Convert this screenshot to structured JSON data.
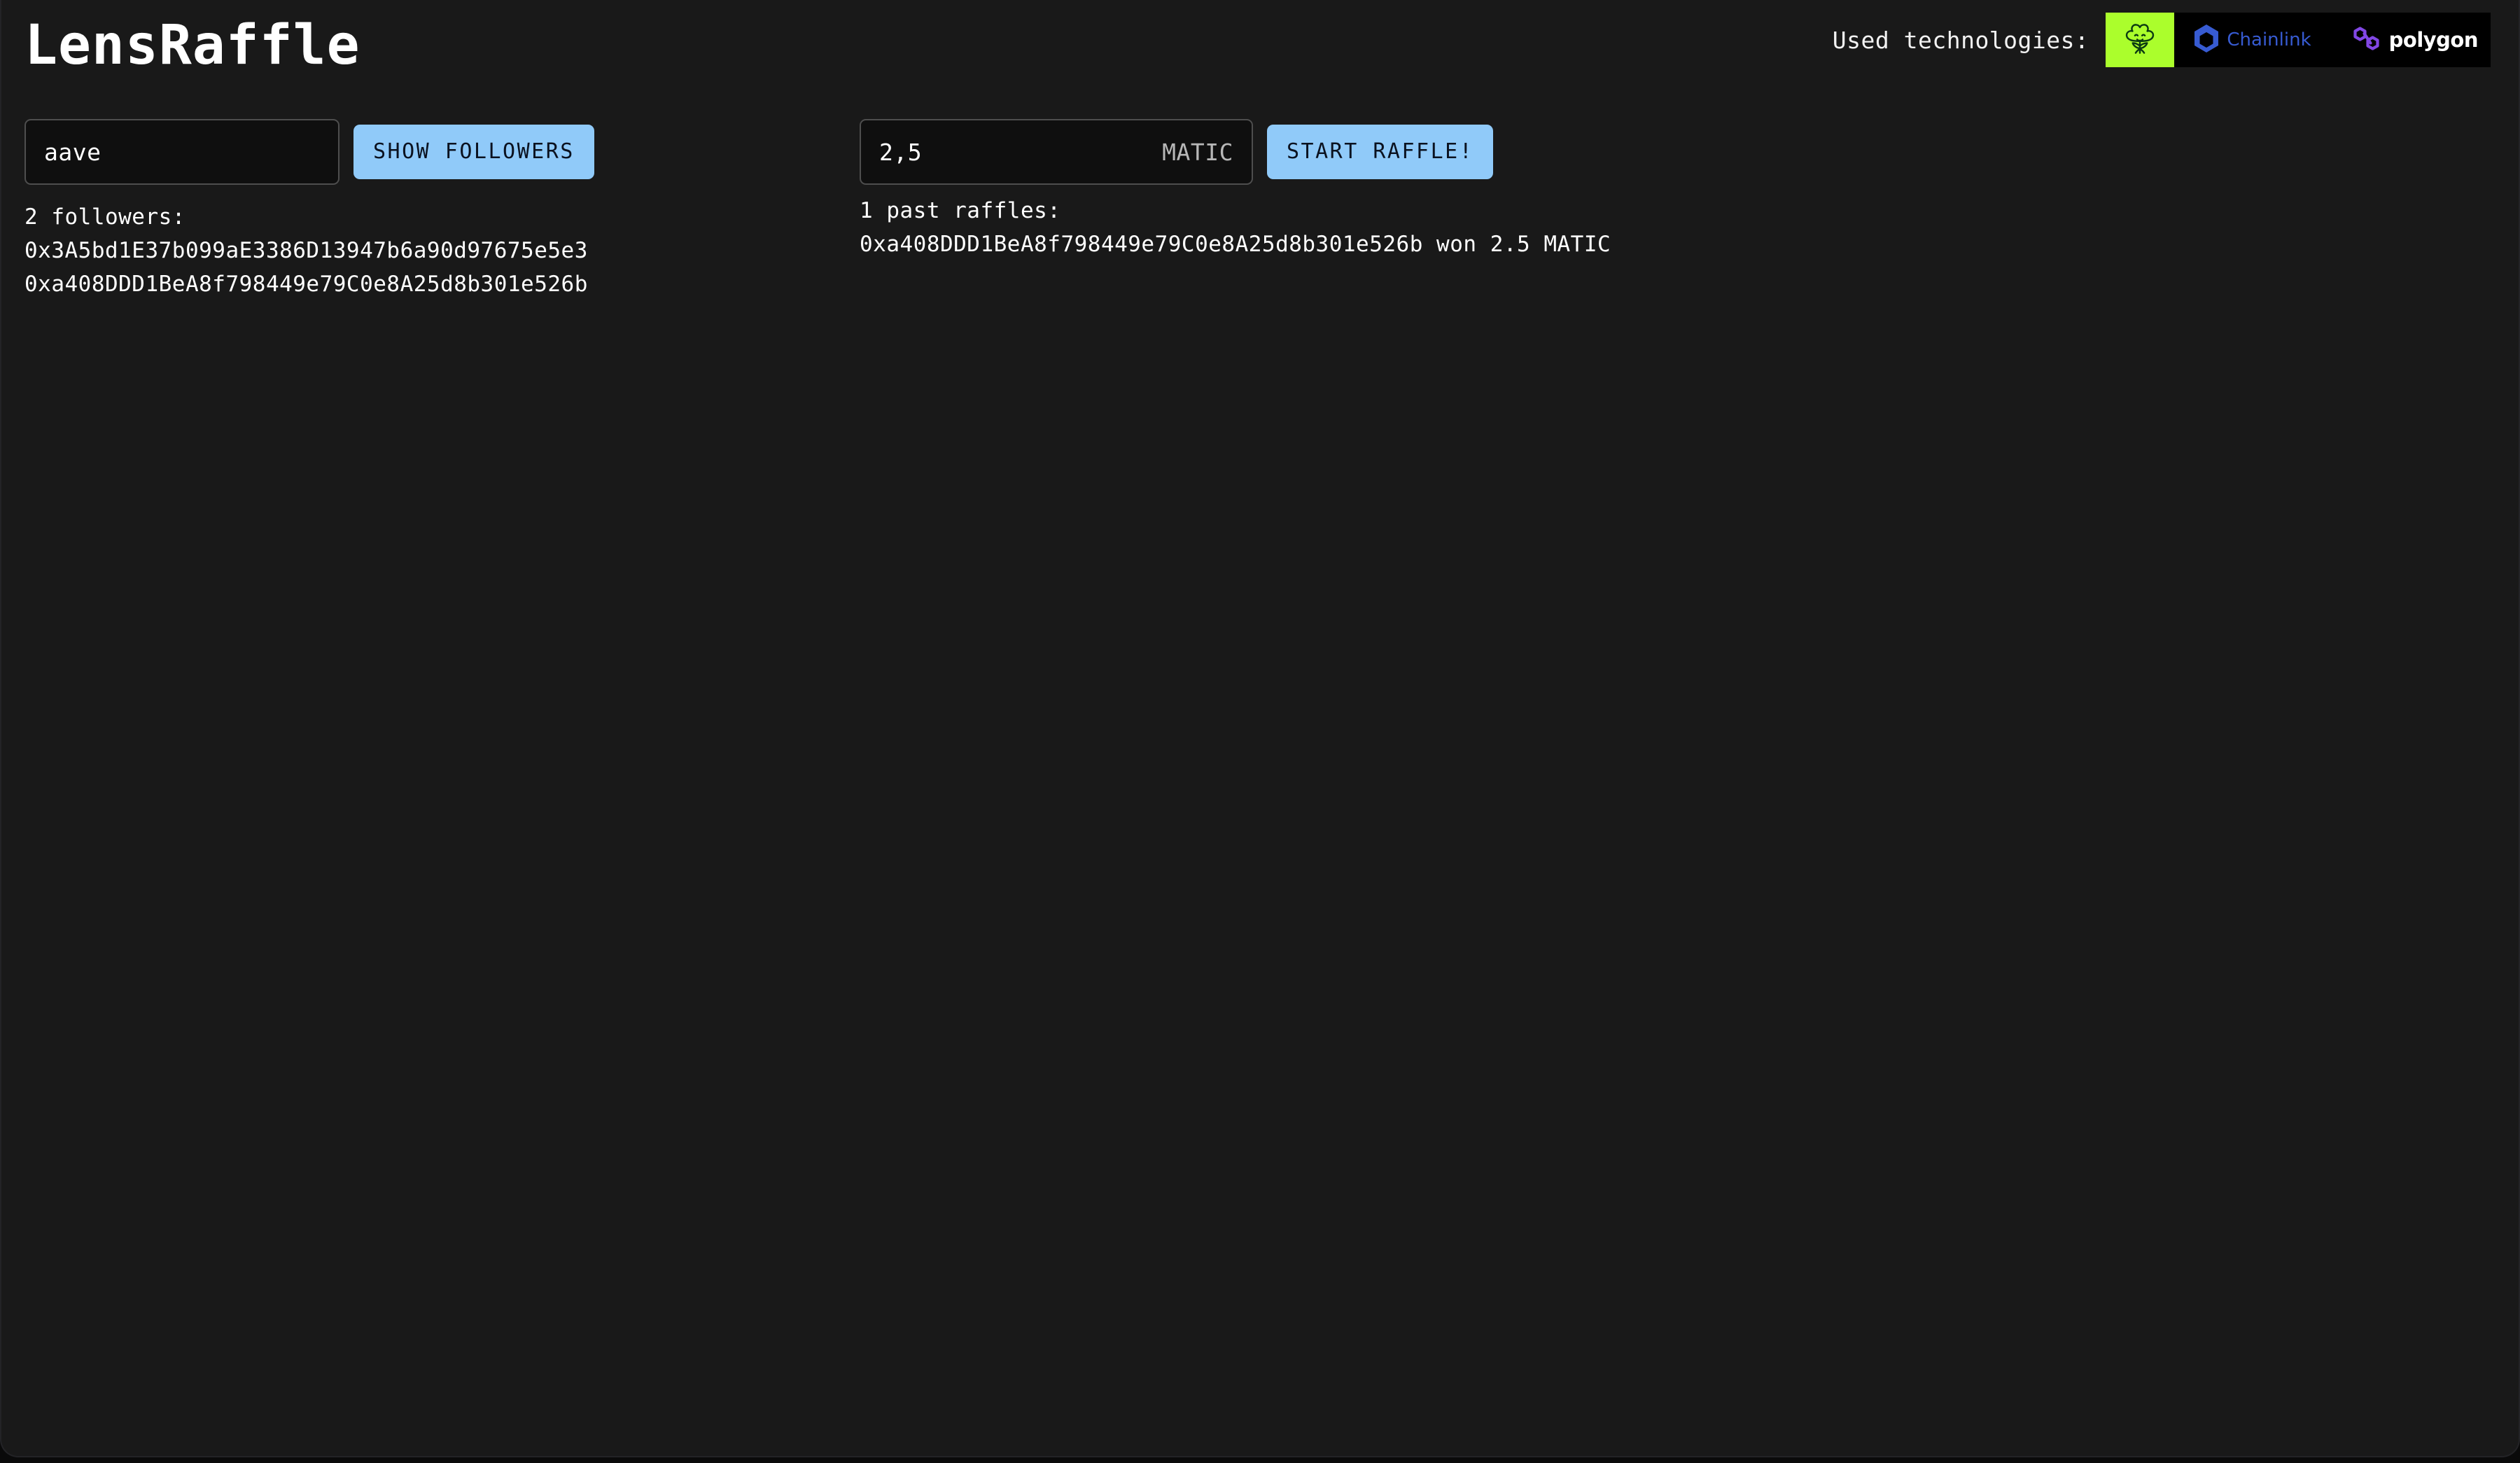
{
  "app": {
    "title": "LensRaffle"
  },
  "header": {
    "tech_label": "Used technologies:",
    "badges": [
      {
        "name": "lens-protocol",
        "icon": "lens-flower-icon",
        "text": "",
        "bg": "#abfe2c"
      },
      {
        "name": "chainlink",
        "icon": "chainlink-hexagon-icon",
        "text": "Chainlink",
        "bg": "#000000",
        "color": "#375bd2"
      },
      {
        "name": "polygon",
        "icon": "polygon-hexagons-icon",
        "text": "polygon",
        "bg": "#000000",
        "color": "#ffffff"
      }
    ]
  },
  "followers_panel": {
    "input": {
      "value": "aave",
      "placeholder": "handle"
    },
    "button_label": "SHOW FOLLOWERS",
    "heading": "2 followers:",
    "items": [
      "0x3A5bd1E37b099aE3386D13947b6a90d97675e5e3",
      "0xa408DDD1BeA8f798449e79C0e8A25d8b301e526b"
    ]
  },
  "raffle_panel": {
    "input": {
      "value": "2,5",
      "placeholder": "amount",
      "suffix": "MATIC"
    },
    "button_label": "START RAFFLE!",
    "heading": "1 past raffles:",
    "items": [
      "0xa408DDD1BeA8f798449e79C0e8A25d8b301e526b won 2.5 MATIC"
    ]
  },
  "theme": {
    "page_bg": "#191919",
    "field_bg": "#0f0f0f",
    "field_border": "#4e4e4e",
    "accent_button": "#90caf9",
    "button_text": "#0b1220",
    "text": "#ffffff",
    "muted_text": "#b7b7b7",
    "lens_green": "#abfe2c",
    "chainlink_blue": "#375bd2",
    "polygon_purple": "#8247e5"
  }
}
